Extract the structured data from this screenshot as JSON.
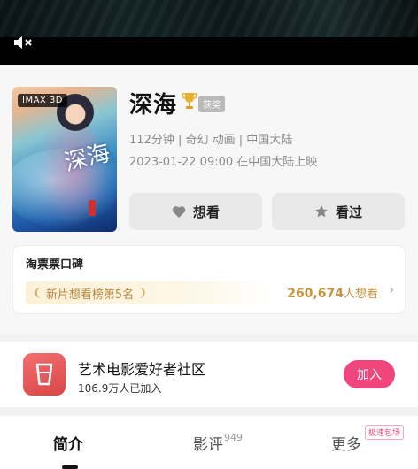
{
  "movie": {
    "title": "深海",
    "award_label": "获奖",
    "poster_badge": "IMAX 3D",
    "poster_title": "深海",
    "meta_line1": "112分钟 | 奇幻 动画 | 中国大陆",
    "meta_line2": "2023-01-22 09:00 在中国大陆上映"
  },
  "actions": {
    "want_label": "想看",
    "seen_label": "看过"
  },
  "reputation": {
    "title": "淘票票口碑",
    "rank_text": "新片想看榜第5名",
    "want_count": "260,674",
    "want_suffix": "人想看"
  },
  "community": {
    "name": "艺术电影爱好者社区",
    "members": "106.9万人已加入",
    "join_label": "加入"
  },
  "tabs": {
    "intro": "简介",
    "review": "影评",
    "review_count": "949",
    "more": "更多",
    "more_badge": "极速包场"
  },
  "colors": {
    "accent": "#f0457d",
    "gold": "#c8923c"
  }
}
